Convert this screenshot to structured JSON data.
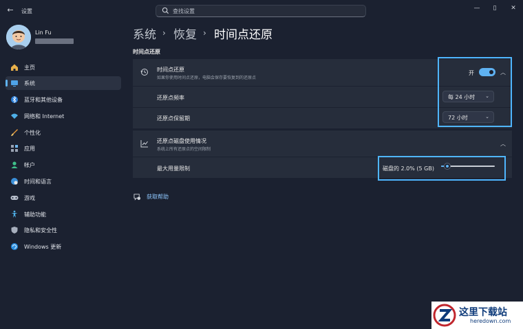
{
  "window": {
    "title": "设置"
  },
  "search": {
    "placeholder": "查找设置"
  },
  "user": {
    "name": "Lin Fu"
  },
  "sidebar": {
    "items": [
      {
        "label": "主页",
        "icon": "home-icon"
      },
      {
        "label": "系统",
        "icon": "system-icon",
        "active": true
      },
      {
        "label": "蓝牙和其他设备",
        "icon": "bluetooth-icon"
      },
      {
        "label": "网络和 Internet",
        "icon": "wifi-icon"
      },
      {
        "label": "个性化",
        "icon": "brush-icon"
      },
      {
        "label": "应用",
        "icon": "apps-icon"
      },
      {
        "label": "帐户",
        "icon": "account-icon"
      },
      {
        "label": "时间和语言",
        "icon": "globe-clock-icon"
      },
      {
        "label": "游戏",
        "icon": "gamepad-icon"
      },
      {
        "label": "辅助功能",
        "icon": "accessibility-icon"
      },
      {
        "label": "隐私和安全性",
        "icon": "shield-icon"
      },
      {
        "label": "Windows 更新",
        "icon": "update-icon"
      }
    ]
  },
  "breadcrumb": {
    "items": [
      "系统",
      "恢复",
      "时间点还原"
    ]
  },
  "section": {
    "title": "时间点还原"
  },
  "restore_card": {
    "title": "时间点还原",
    "subtitle": "如果你使用时间点还原，电脑会保存要恢复到的还原点",
    "toggle_label": "开",
    "toggle_on": true,
    "rows": [
      {
        "label": "还原点频率",
        "value": "每 24 小时"
      },
      {
        "label": "还原点保留期",
        "value": "72 小时"
      }
    ]
  },
  "usage_card": {
    "title": "还原点磁盘使用情况",
    "subtitle": "系统上所有还原点的空间限制",
    "row_label": "最大用量限制",
    "slider_text": "磁盘的 2.0% (5 GB)",
    "slider_value_percent": 2.0
  },
  "help": {
    "label": "获取帮助"
  },
  "watermark": {
    "cn": "这里下载站",
    "en": "heredown.com"
  },
  "colors": {
    "accent": "#5fb2f2",
    "highlight": "#4fb6ff",
    "background": "#1b2130",
    "card": "#262d3b"
  }
}
